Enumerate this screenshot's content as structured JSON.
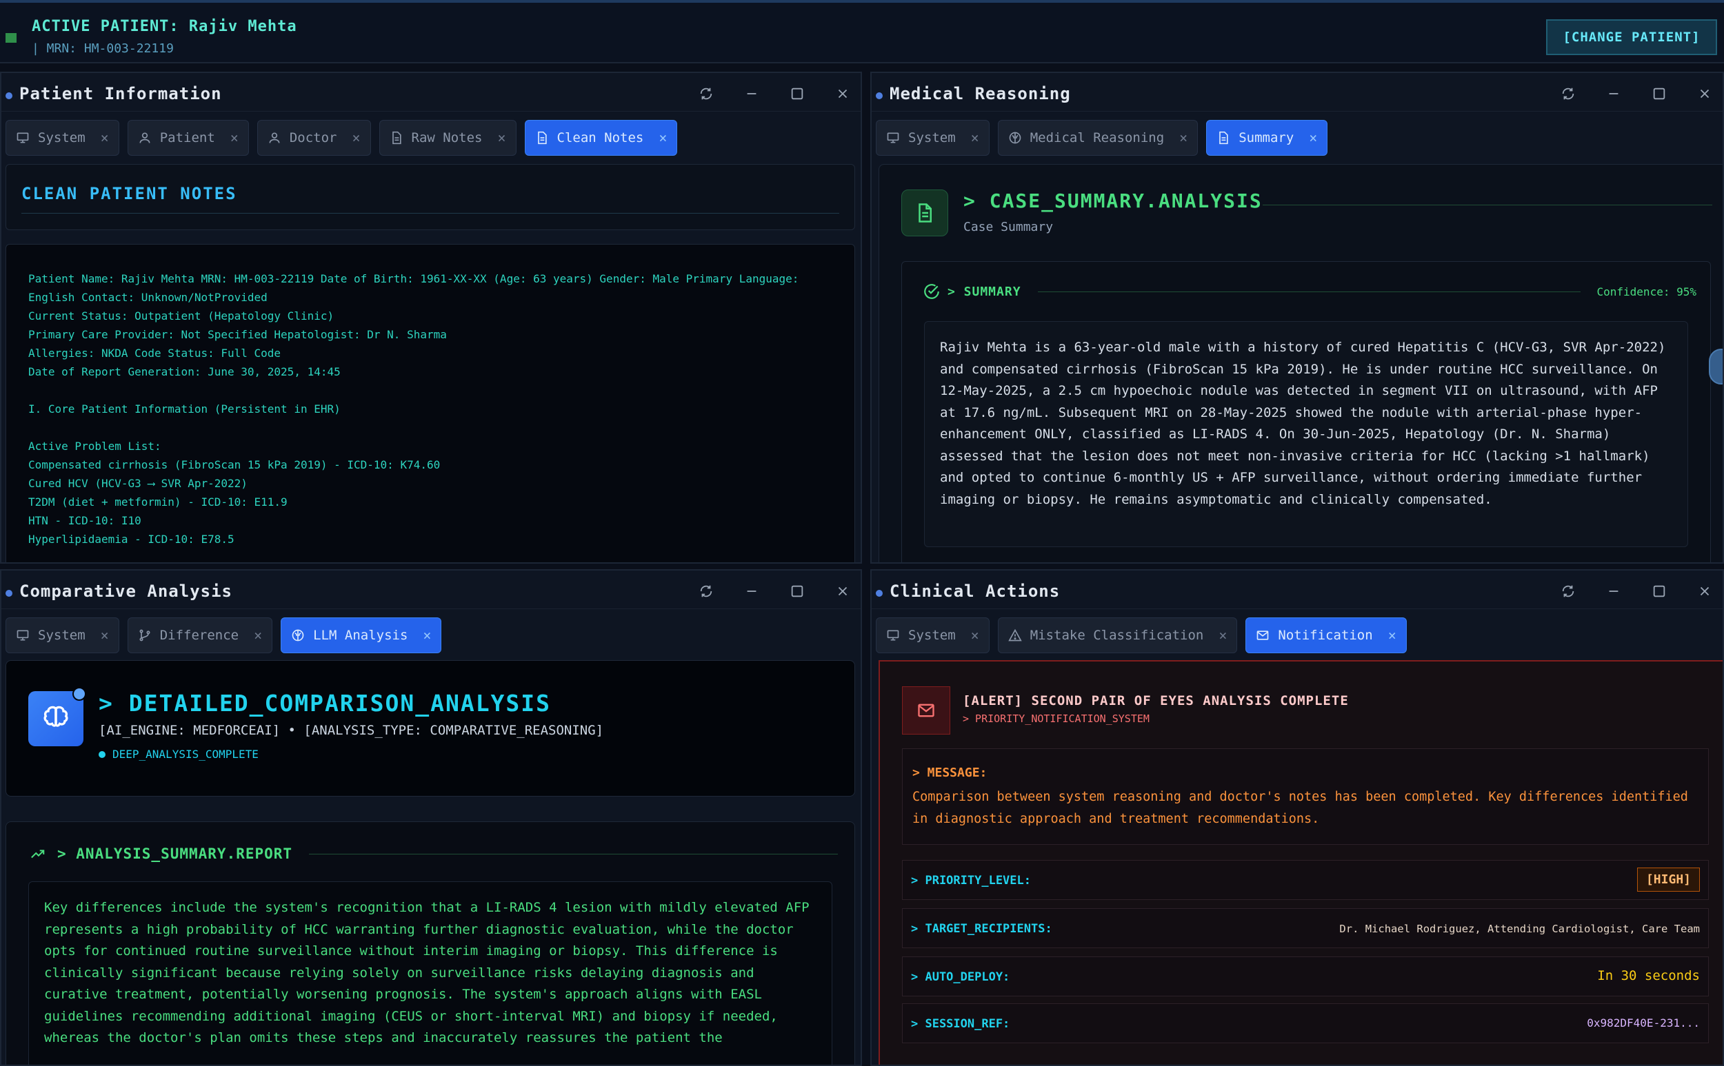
{
  "header": {
    "active_patient": "ACTIVE PATIENT: Rajiv Mehta",
    "mrn": "| MRN: HM-003-22119",
    "change_patient": "[CHANGE PATIENT]"
  },
  "patient_info": {
    "title": "Patient Information",
    "tabs": [
      {
        "label": "System",
        "icon": "monitor-icon"
      },
      {
        "label": "Patient",
        "icon": "user-icon"
      },
      {
        "label": "Doctor",
        "icon": "user-icon"
      },
      {
        "label": "Raw Notes",
        "icon": "document-icon"
      },
      {
        "label": "Clean Notes",
        "icon": "document-icon",
        "active": true
      }
    ],
    "heading": "CLEAN PATIENT NOTES",
    "notes": "Patient Name: Rajiv Mehta MRN: HM-003-22119 Date of Birth: 1961-XX-XX (Age: 63 years) Gender: Male Primary Language:\nEnglish Contact: Unknown/NotProvided\nCurrent Status: Outpatient (Hepatology Clinic)\nPrimary Care Provider: Not Specified Hepatologist: Dr N. Sharma\nAllergies: NKDA Code Status: Full Code\nDate of Report Generation: June 30, 2025, 14:45\n\nI. Core Patient Information (Persistent in EHR)\n\nActive Problem List:\nCompensated cirrhosis (FibroScan 15 kPa 2019) - ICD-10: K74.60\nCured HCV (HCV-G3 ⟶ SVR Apr-2022)\nT2DM (diet + metformin) - ICD-10: E11.9\nHTN - ICD-10: I10\nHyperlipidaemia - ICD-10: E78.5"
  },
  "medical_reasoning": {
    "title": "Medical Reasoning",
    "tabs": [
      {
        "label": "System",
        "icon": "monitor-icon"
      },
      {
        "label": "Medical Reasoning",
        "icon": "brain-icon"
      },
      {
        "label": "Summary",
        "icon": "document-icon",
        "active": true
      }
    ],
    "heading": "> CASE_SUMMARY.ANALYSIS",
    "subheading": "Case Summary",
    "summary_label": "> SUMMARY",
    "confidence": "Confidence: 95%",
    "summary": "Rajiv Mehta is a 63-year-old male with a history of cured Hepatitis C (HCV-G3, SVR Apr-2022) and compensated cirrhosis (FibroScan 15 kPa 2019). He is under routine HCC surveillance. On 12-May-2025, a 2.5 cm hypoechoic nodule was detected in segment VII on ultrasound, with AFP at 17.6 ng/mL. Subsequent MRI on 28-May-2025 showed the nodule with arterial-phase hyper-enhancement ONLY, classified as LI-RADS 4. On 30-Jun-2025, Hepatology (Dr. N. Sharma) assessed that the lesion does not meet non-invasive criteria for HCC (lacking >1 hallmark) and opted to continue 6-monthly US + AFP surveillance, without ordering immediate further imaging or biopsy. He remains asymptomatic and clinically compensated."
  },
  "comparative": {
    "title": "Comparative Analysis",
    "tabs": [
      {
        "label": "System",
        "icon": "monitor-icon"
      },
      {
        "label": "Difference",
        "icon": "branch-icon"
      },
      {
        "label": "LLM Analysis",
        "icon": "brain-icon",
        "active": true
      }
    ],
    "heading": "> DETAILED_COMPARISON_ANALYSIS",
    "meta": "[AI_ENGINE: MEDFORCEAI] • [ANALYSIS_TYPE: COMPARATIVE_REASONING]",
    "status": "DEEP_ANALYSIS_COMPLETE",
    "report_label": "> ANALYSIS_SUMMARY.REPORT",
    "report": "Key differences include the system's recognition that a LI-RADS 4 lesion with mildly elevated AFP represents a high probability of HCC warranting further diagnostic evaluation, while the doctor opts for continued routine surveillance without interim imaging or biopsy. This difference is clinically significant because relying solely on surveillance risks delaying diagnosis and curative treatment, potentially worsening prognosis. The system's approach aligns with EASL guidelines recommending additional imaging (CEUS or short-interval MRI) and biopsy if needed, whereas the doctor's plan omits these steps and inaccurately reassures the patient the"
  },
  "clinical_actions": {
    "title": "Clinical Actions",
    "tabs": [
      {
        "label": "System",
        "icon": "monitor-icon"
      },
      {
        "label": "Mistake Classification",
        "icon": "warning-icon"
      },
      {
        "label": "Notification",
        "icon": "mail-icon",
        "active": true
      }
    ],
    "alert_title": "[ALERT] SECOND PAIR OF EYES ANALYSIS COMPLETE",
    "alert_sub": "> PRIORITY_NOTIFICATION_SYSTEM",
    "message_label": "> MESSAGE:",
    "message": "Comparison between system reasoning and doctor's notes has been completed. Key differences identified in diagnostic approach and treatment recommendations.",
    "priority_label": "> PRIORITY_LEVEL:",
    "priority_value": "[HIGH]",
    "targets_label": "> TARGET_RECIPIENTS:",
    "targets_value": "Dr. Michael Rodriguez, Attending Cardiologist, Care Team",
    "deploy_label": "> AUTO_DEPLOY:",
    "deploy_value": "In 30 seconds",
    "session_label": "> SESSION_REF:",
    "session_value": "0x982DF40E-231..."
  }
}
